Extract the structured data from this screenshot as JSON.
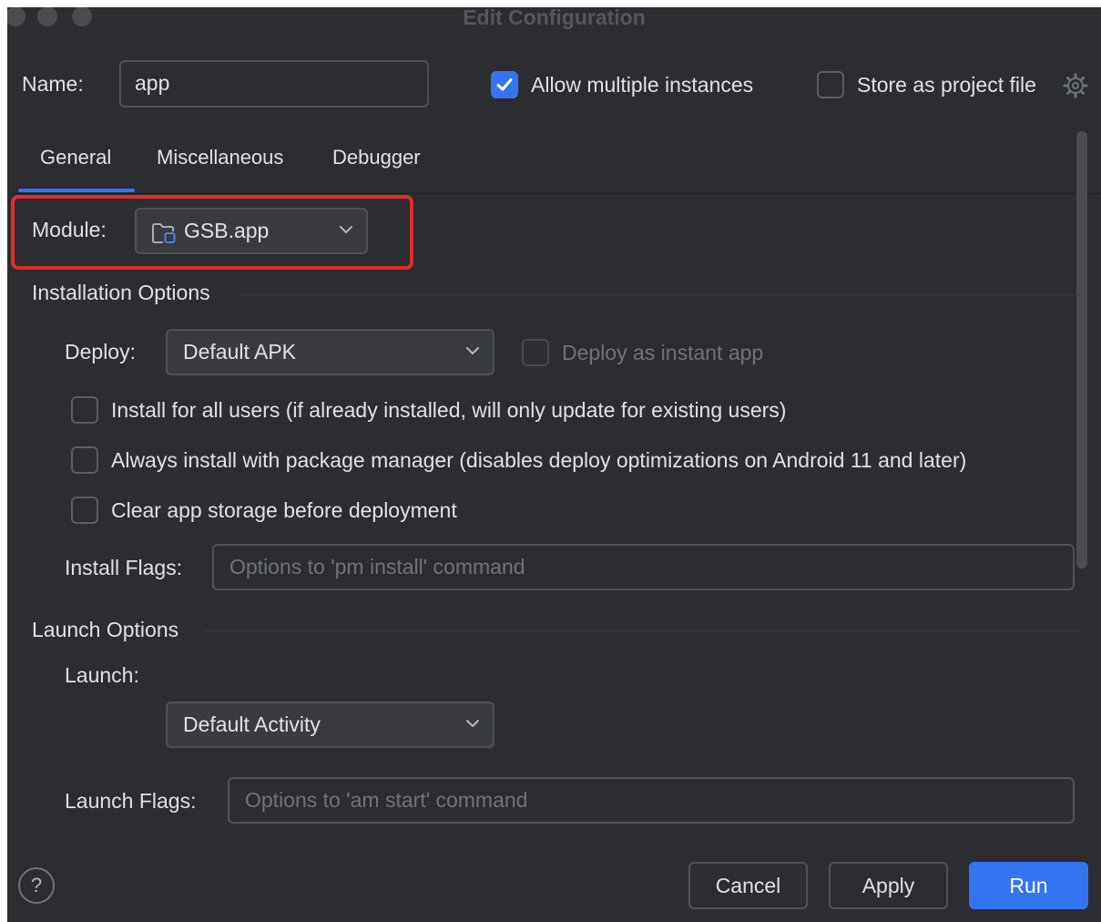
{
  "window": {
    "title": "Edit Configuration"
  },
  "header": {
    "name_label": "Name:",
    "name_value": "app",
    "allow_multiple": {
      "label": "Allow multiple instances",
      "checked": true
    },
    "store_project": {
      "label": "Store as project file",
      "checked": false
    }
  },
  "tabs": [
    {
      "label": "General",
      "selected": true
    },
    {
      "label": "Miscellaneous",
      "selected": false
    },
    {
      "label": "Debugger",
      "selected": false
    }
  ],
  "module": {
    "label": "Module:",
    "value": "GSB.app",
    "icon": "folder-module-icon"
  },
  "installation": {
    "title": "Installation Options",
    "deploy_label": "Deploy:",
    "deploy_value": "Default APK",
    "instant_app": {
      "label": "Deploy as instant app",
      "checked": false,
      "enabled": false
    },
    "options": [
      {
        "label": "Install for all users (if already installed, will only update for existing users)",
        "checked": false
      },
      {
        "label": "Always install with package manager (disables deploy optimizations on Android 11 and later)",
        "checked": false
      },
      {
        "label": "Clear app storage before deployment",
        "checked": false
      }
    ],
    "flags_label": "Install Flags:",
    "flags_placeholder": "Options to 'pm install' command"
  },
  "launch": {
    "title": "Launch Options",
    "launch_label": "Launch:",
    "launch_value": "Default Activity",
    "flags_label": "Launch Flags:",
    "flags_placeholder": "Options to 'am start' command"
  },
  "footer": {
    "help_label": "?",
    "cancel_label": "Cancel",
    "apply_label": "Apply",
    "run_label": "Run"
  },
  "colors": {
    "background": "#2b2d30",
    "accent": "#3574f0",
    "highlight": "#e52b2b"
  }
}
